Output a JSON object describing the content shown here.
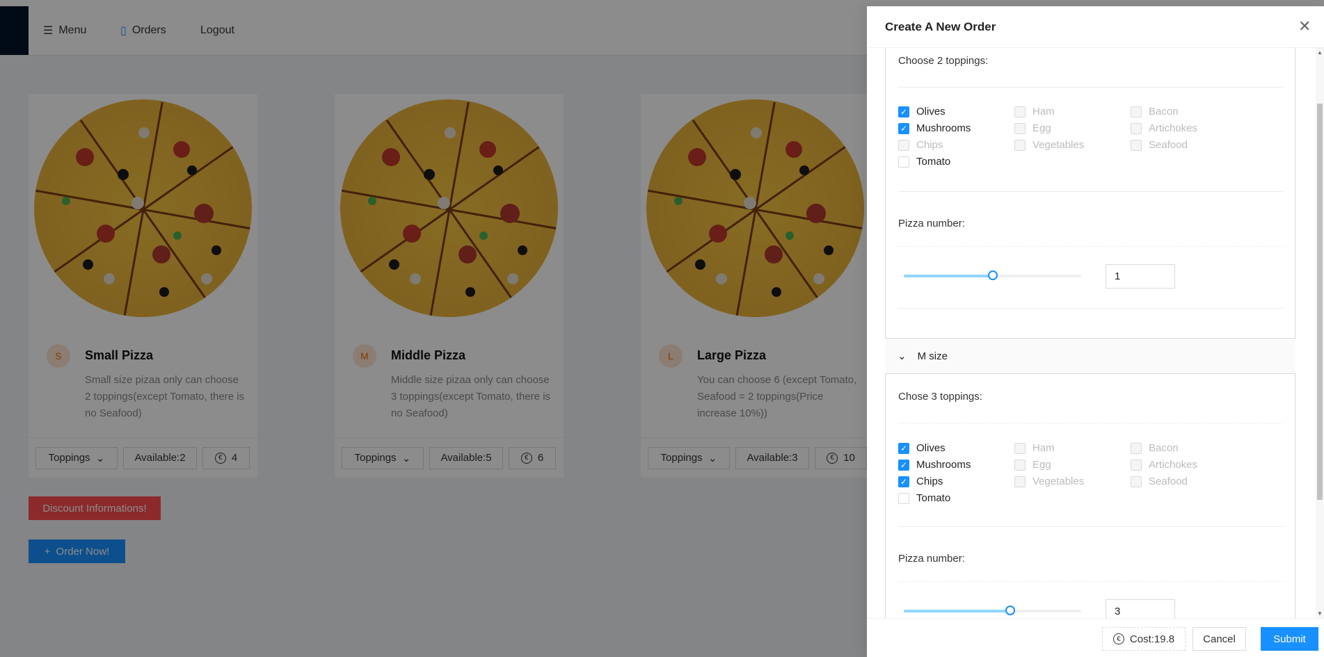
{
  "nav": {
    "menu_label": "Menu",
    "orders_label": "Orders",
    "logout_label": "Logout"
  },
  "cards": [
    {
      "avatar": "S",
      "title": "Small Pizza",
      "desc": "Small size pizaa only can choose 2 toppings(except Tomato, there is no Seafood)",
      "toppings_label": "Toppings",
      "available": "Available:2",
      "price": "4"
    },
    {
      "avatar": "M",
      "title": "Middle Pizza",
      "desc": "Middle size pizaa only can choose 3 toppings(except Tomato, there is no Seafood)",
      "toppings_label": "Toppings",
      "available": "Available:5",
      "price": "6"
    },
    {
      "avatar": "L",
      "title": "Large Pizza",
      "desc": "You can choose 6 (except Tomato, Seafood = 2 toppings(Price increase 10%))",
      "toppings_label": "Toppings",
      "available": "Available:3",
      "price": "10"
    }
  ],
  "discount_button": "Discount Informations!",
  "order_button": "Order Now!",
  "drawer": {
    "title": "Create A New Order",
    "sections": [
      {
        "toppings_prompt": "Choose 2 toppings:",
        "toppings": [
          {
            "label": "Olives",
            "state": "checked"
          },
          {
            "label": "Ham",
            "state": "disabled"
          },
          {
            "label": "Bacon",
            "state": "disabled"
          },
          {
            "label": "Mushrooms",
            "state": "checked"
          },
          {
            "label": "Egg",
            "state": "disabled"
          },
          {
            "label": "Artichokes",
            "state": "disabled"
          },
          {
            "label": "Chips",
            "state": "disabled"
          },
          {
            "label": "Vegetables",
            "state": "disabled"
          },
          {
            "label": "Seafood",
            "state": "disabled"
          },
          {
            "label": "Tomato",
            "state": "enabled"
          }
        ],
        "pizza_number_label": "Pizza number:",
        "pizza_number": "1",
        "slider_fraction": 0.5
      },
      {
        "header": "M size",
        "toppings_prompt": "Chose 3 toppings:",
        "toppings": [
          {
            "label": "Olives",
            "state": "checked"
          },
          {
            "label": "Ham",
            "state": "disabled"
          },
          {
            "label": "Bacon",
            "state": "disabled"
          },
          {
            "label": "Mushrooms",
            "state": "checked"
          },
          {
            "label": "Egg",
            "state": "disabled"
          },
          {
            "label": "Artichokes",
            "state": "disabled"
          },
          {
            "label": "Chips",
            "state": "checked"
          },
          {
            "label": "Vegetables",
            "state": "disabled"
          },
          {
            "label": "Seafood",
            "state": "disabled"
          },
          {
            "label": "Tomato",
            "state": "enabled"
          }
        ],
        "pizza_number_label": "Pizza number:",
        "pizza_number": "3",
        "slider_fraction": 0.6
      }
    ],
    "footer": {
      "cost": "Cost:19.8",
      "cancel": "Cancel",
      "submit": "Submit"
    }
  }
}
